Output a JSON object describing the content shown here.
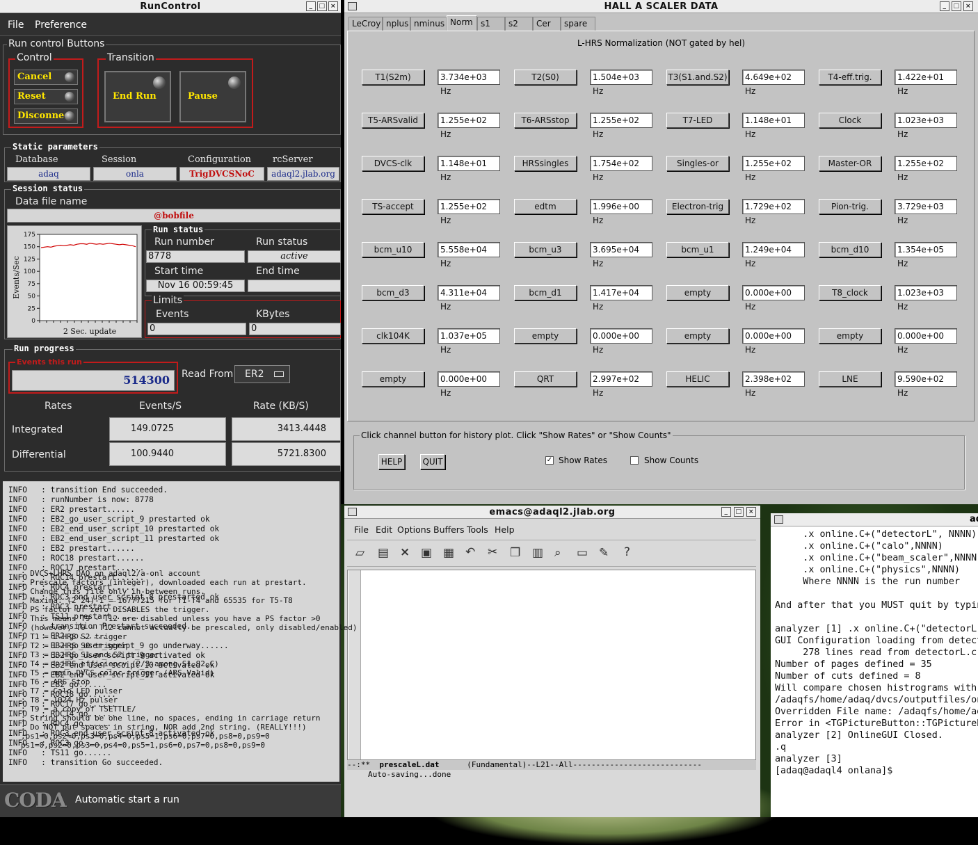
{
  "runcontrol": {
    "title": "RunControl",
    "menu": {
      "file": "File",
      "preference": "Preference"
    },
    "run_control_buttons_label": "Run control Buttons",
    "control_label": "Control",
    "transition_label": "Transition",
    "cancel": "Cancel",
    "reset": "Reset",
    "disconnect": "Disconnect",
    "end_run": "End Run",
    "pause": "Pause",
    "static_params_label": "Static parameters",
    "database_label": "Database",
    "session_label": "Session",
    "configuration_label": "Configuration",
    "rcserver_label": "rcServer",
    "database": "adaq",
    "session": "onla",
    "configuration": "TrigDVCSNoC",
    "rcserver": "adaql2.jlab.org",
    "session_status_label": "Session status",
    "data_file_label": "Data file name",
    "data_file": "@bobfile",
    "chart_ylabel": "Events/Sec",
    "chart_caption": "2 Sec. update",
    "run_status_header": "Run status",
    "run_number_label": "Run number",
    "run_number": "8778",
    "run_status_label": "Run status",
    "run_status": "active",
    "start_time_label": "Start time",
    "start_time": "Nov 16 00:59:45",
    "end_time_label": "End time",
    "end_time": "",
    "limits_label": "Limits",
    "events_limit_label": "Events",
    "events_limit": "0",
    "kbytes_limit_label": "KBytes",
    "kbytes_limit": "0",
    "run_progress_label": "Run progress",
    "events_this_run_label": "Events this run",
    "events_this_run": "514300",
    "read_from_label": "Read From:",
    "read_from": "ER2",
    "rates_header": "Rates",
    "events_s_header": "Events/S",
    "rate_kbs_header": "Rate (KB/S)",
    "integrated_label": "Integrated",
    "integrated_events": "149.0725",
    "integrated_rate": "3413.4448",
    "differential_label": "Differential",
    "differential_events": "100.9440",
    "differential_rate": "5721.8300",
    "log": [
      "INFO   : transition End succeeded.",
      "INFO   : runNumber is now: 8778",
      "INFO   : ER2 prestart......",
      "INFO   : EB2_go_user_script_9 prestarted ok",
      "INFO   : EB2_end_user_script_10 prestarted ok",
      "INFO   : EB2_end_user_script_11 prestarted ok",
      "INFO   : EB2 prestart......",
      "INFO   : ROC18 prestart......",
      "INFO   : ROC17 prestart......",
      "INFO   : ROC14 prestart......",
      "INFO   : ROC4 prestart......",
      "INFO   : ROC3_end_user_script_8 prestarted ok",
      "INFO   : ROC3 prestart......",
      "INFO   : TS11 prestart......",
      "INFO   : transition Prestart succeeded.",
      "INFO   : ER2 go......",
      "INFO   : EB2_go_user_script_9 go underway......",
      "INFO   : EB2_go_user_script_9 activated ok",
      "INFO   : EB2_end_user_script_10 activated ok",
      "INFO   : EB2_end_user_script_11 activated ok",
      "INFO   : EB2 go......",
      "INFO   : ROC18 go......",
      "INFO   : ROC17 go......",
      "INFO   : ROC14 go......",
      "INFO   : ROC4 go......",
      "INFO   : ROC3_end_user_script_8 activated ok",
      "INFO   : ROC3 go......",
      "INFO   : TS11 go......",
      "INFO   : transition Go succeeded."
    ],
    "coda_logo": "CODA",
    "status_text": "Automatic start a run",
    "chart_data": {
      "type": "line",
      "title": "",
      "xlabel": "2 Sec. update",
      "ylabel": "Events/Sec",
      "ylim": [
        0,
        175
      ],
      "yticks": [
        0,
        25,
        50,
        75,
        100,
        125,
        150,
        175
      ],
      "series": [
        {
          "values": [
            148,
            149,
            150,
            149,
            151,
            152,
            153,
            152,
            153,
            154,
            153,
            155,
            156,
            156,
            155,
            157,
            156,
            155,
            156,
            155,
            156,
            157,
            156,
            155,
            154,
            155,
            154,
            153,
            152,
            150
          ]
        }
      ]
    }
  },
  "scaler": {
    "title": "HALL  A  SCALER  DATA",
    "tabs": [
      "LeCroy",
      "nplus",
      "nminus",
      "Norm",
      "s1",
      "s2",
      "Cer",
      "spare"
    ],
    "active_tab": "Norm",
    "panel_title": "L-HRS Normalization (NOT gated by hel)",
    "channels": [
      [
        [
          "T1(S2m)",
          "3.734e+03 Hz"
        ],
        [
          "T2(S0)",
          "1.504e+03 Hz"
        ],
        [
          "T3(S1.and.S2)",
          "4.649e+02 Hz"
        ],
        [
          "T4-eff.trig.",
          "1.422e+01 Hz"
        ]
      ],
      [
        [
          "T5-ARSvalid",
          "1.255e+02 Hz"
        ],
        [
          "T6-ARSstop",
          "1.255e+02 Hz"
        ],
        [
          "T7-LED",
          "1.148e+01 Hz"
        ],
        [
          "Clock",
          "1.023e+03 Hz"
        ]
      ],
      [
        [
          "DVCS-clk",
          "1.148e+01 Hz"
        ],
        [
          "HRSsingles",
          "1.754e+02 Hz"
        ],
        [
          "Singles-or",
          "1.255e+02 Hz"
        ],
        [
          "Master-OR",
          "1.255e+02 Hz"
        ]
      ],
      [
        [
          "TS-accept",
          "1.255e+02 Hz"
        ],
        [
          "edtm",
          "1.996e+00 Hz"
        ],
        [
          "Electron-trig",
          "1.729e+02 Hz"
        ],
        [
          "Pion-trig.",
          "3.729e+03 Hz"
        ]
      ],
      [
        [
          "bcm_u10",
          "5.558e+04 Hz"
        ],
        [
          "bcm_u3",
          "3.695e+04 Hz"
        ],
        [
          "bcm_u1",
          "1.249e+04 Hz"
        ],
        [
          "bcm_d10",
          "1.354e+05 Hz"
        ]
      ],
      [
        [
          "bcm_d3",
          "4.311e+04 Hz"
        ],
        [
          "bcm_d1",
          "1.417e+04 Hz"
        ],
        [
          "empty",
          "0.000e+00 Hz"
        ],
        [
          "T8_clock",
          "1.023e+03 Hz"
        ]
      ],
      [
        [
          "clk104K",
          "1.037e+05 Hz"
        ],
        [
          "empty",
          "0.000e+00 Hz"
        ],
        [
          "empty",
          "0.000e+00 Hz"
        ],
        [
          "empty",
          "0.000e+00 Hz"
        ]
      ],
      [
        [
          "empty",
          "0.000e+00 Hz"
        ],
        [
          "QRT",
          "2.997e+02 Hz"
        ],
        [
          "HELIC",
          "2.398e+02 Hz"
        ],
        [
          "LNE",
          "9.590e+02 Hz"
        ]
      ]
    ],
    "bottom_title": "Click channel button for history plot.  Click \"Show Rates\" or \"Show Counts\"",
    "help": "HELP",
    "quit": "QUIT",
    "show_rates": "Show Rates",
    "show_counts": "Show Counts",
    "show_rates_checked": true,
    "show_counts_checked": false
  },
  "emacs": {
    "title": "emacs@adaql2.jlab.org",
    "menu": [
      "File",
      "Edit",
      "Options",
      "Buffers",
      "Tools",
      "Help"
    ],
    "lines": [
      "; DVCS+LHRS DAQ on adaql2/a-onl account",
      "; Prescale factors (integer), downloaded each run at prestart.",
      "; Change this file only in-between runs.",
      "; Maxima: (2^24)-1 = 16777215 for T1-T4 and 65535 for T5-T8",
      "; PS factor of zero DISABLES the trigger.",
      "; This means T9 - T12 are disabled unless you have a PS factor >0",
      "; (however, T9 - T12 cannot actually be prescaled, only disabled/enabled)",
      "; T1 = L-HRS S2 trigger",
      "; T2 = L-HRS S0 trigger",
      "; T3 = L-HRS S1.and.S2 trigger",
      "; T4 = L-HRS efficiency (2/3 among S1,S2,C)",
      "; T5 = main DVCS coinc trigger (ARS Valid)",
      "; T6 = ARS Stop",
      "; T7 = Calo LED pulser",
      "; T8 = 1024 Hz pulser",
      "; T9 = a copy of TSETTLE/",
      "; String should be one line, no spaces, ending in carriage return",
      "; Do NOT put spaces in string, NOR add 2nd string. (REALLY!!!)",
      ";ps1=0,ps2=0,ps3=0,ps4=0,ps5=1,ps6=0,ps7=0,ps8=0,ps9=0",
      "ps1=0,ps2=0,ps3=0,ps4=0,ps5=1,ps6=0,ps7=0,ps8=0,ps9=0"
    ],
    "modeline_prefix": "--:**",
    "modeline_file": "prescaleL.dat",
    "modeline_mode": "(Fundamental)--L21--All----------------------------",
    "minibuffer": "Auto-saving...done"
  },
  "terminal": {
    "title": "ad",
    "lines": [
      "     .x online.C+(\"detectorL\", NNNN)",
      "     .x online.C+(\"calo\",NNNN)",
      "     .x online.C+(\"beam_scaler\",NNNN",
      "     .x online.C+(\"physics\",NNNN)",
      "     Where NNNN is the run number",
      "",
      "And after that you MUST quit by typin",
      "",
      "analyzer [1] .x online.C+(\"detectorL",
      "GUI Configuration loading from detect",
      "     278 lines read from detectorL.c",
      "Number of pages defined = 35",
      "Number of cuts defined = 8",
      "Will compare chosen histrograms with",
      "/adaqfs/home/adaq/dvcs/outputfiles/on",
      "Overridden File name: /adaqfs/home/ad",
      "Error in <TGPictureButton::TGPictureB",
      "analyzer [2] OnlineGUI Closed.",
      ".q",
      "analyzer [3]",
      "[adaq@adaql4 onlana]$ "
    ]
  }
}
